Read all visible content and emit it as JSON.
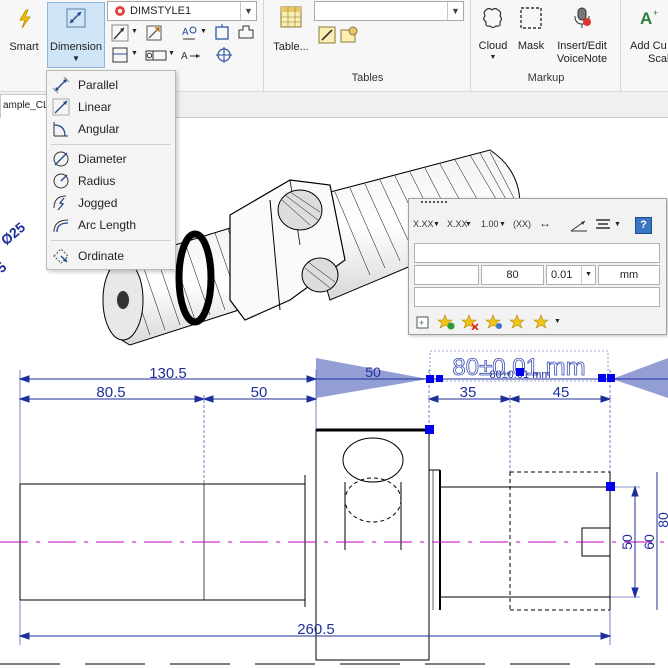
{
  "ribbon": {
    "smart_label": "Smart",
    "dimension_label": "Dimension",
    "dimstyle_value": "DIMSTYLE1",
    "table_label": "Table...",
    "tables_group": "Tables",
    "cloud_label": "Cloud",
    "mask_label": "Mask",
    "voice_label_1": "Insert/Edit",
    "voice_label_2": "VoiceNote",
    "markup_group": "Markup",
    "add_label_1": "Add Cu",
    "add_label_2": "Scal"
  },
  "tab": {
    "label": "ample_CL"
  },
  "menu": {
    "items": [
      {
        "label": "Parallel",
        "icon": "parallel-dim-icon"
      },
      {
        "label": "Linear",
        "icon": "linear-dim-icon"
      },
      {
        "label": "Angular",
        "icon": "angular-dim-icon"
      },
      {
        "label": "Diameter",
        "icon": "diameter-dim-icon"
      },
      {
        "label": "Radius",
        "icon": "radius-dim-icon"
      },
      {
        "label": "Jogged",
        "icon": "jogged-dim-icon"
      },
      {
        "label": "Arc Length",
        "icon": "arc-length-icon"
      },
      {
        "label": "Ordinate",
        "icon": "ordinate-dim-icon"
      }
    ]
  },
  "format_panel": {
    "tool_labels": [
      "X.XX",
      "X.XX",
      "1.00",
      "(XX)",
      "↔"
    ],
    "value": "80",
    "tolerance": "0.01",
    "unit": "mm"
  },
  "drawing": {
    "dims": {
      "d130": "130.5",
      "d80_5": "80.5",
      "d50": "50",
      "d35": "35",
      "d45": "45",
      "d50_side": "50",
      "d60_side": "60",
      "d80_side": "80",
      "d260": "260.5",
      "d50_partial": "50",
      "preview": "80±0.01 mm",
      "preview_small": "80±0.01 mm",
      "dia25": "Ø25",
      "frag5": "5"
    }
  },
  "colors": {
    "dimension": "#1f2f9a",
    "centerline": "#c000c0",
    "grip": "#0000ee",
    "menu_hover": "#cfe4f7"
  }
}
